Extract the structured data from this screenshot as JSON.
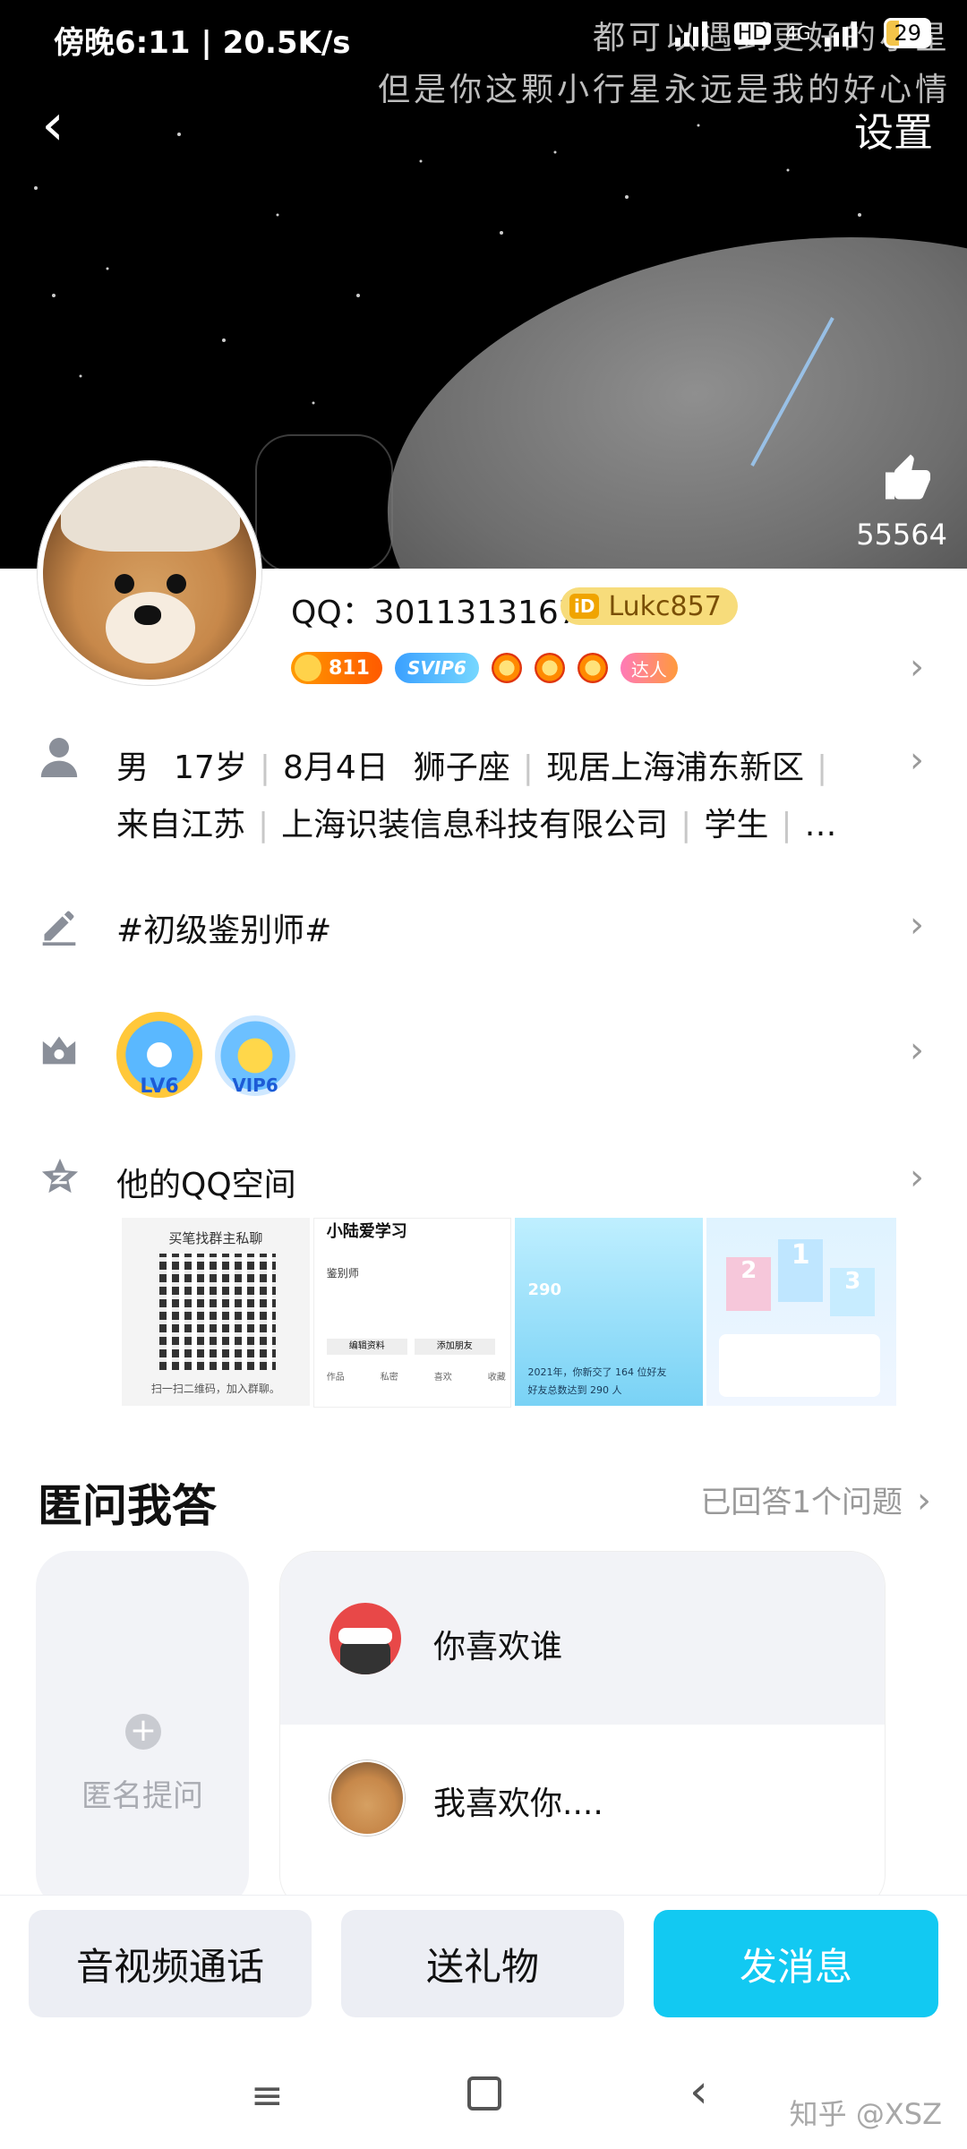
{
  "status_bar": {
    "time_speed": "傍晚6:11 | 20.5K/s",
    "hd": "HD",
    "network": "4G",
    "battery": "29"
  },
  "header": {
    "overlay_text_line1": "都可以遇到更好的小星",
    "overlay_text_line2": "但是你这颗小行星永远是我的好心情",
    "settings_label": "设置",
    "like_count": "55564",
    "back_icon": "chevron-left-icon",
    "like_icon": "thumbs-up-icon"
  },
  "profile": {
    "qq_label": "QQ：3011313167",
    "id_mark": "iD",
    "custom_id": "Lukc857",
    "level_badge": "811",
    "vip_badge": "SVIP6",
    "talent_badge": "达人"
  },
  "info_rows": {
    "basic_info_items": [
      "男",
      "17岁",
      "8月4日",
      "狮子座",
      "现居上海浦东新区"
    ],
    "basic_info_items_line2": [
      "来自江苏",
      "上海识装信息科技有限公司",
      "学生",
      "…"
    ],
    "signature": "#初级鉴别师#",
    "medals": [
      "LV6",
      "VIP6"
    ],
    "qzone_label": "他的QQ空间"
  },
  "gallery": {
    "thumb1_caption_top": "买笔找群主私聊",
    "thumb1_caption_bottom": "扫一扫二维码，加入群聊。",
    "thumb2_title": "小陆爱学习",
    "thumb2_tag": "鉴别师",
    "thumb2_tabs": [
      "作品",
      "私密",
      "喜欢",
      "收藏"
    ],
    "thumb2_buttons": [
      "编辑资料",
      "添加朋友"
    ],
    "thumb3_value": "290",
    "thumb3_line1": "2021年，你新交了 164 位好友",
    "thumb3_line2": "好友总数达到 290 人",
    "thumb4_ranks": [
      "1",
      "2",
      "3"
    ]
  },
  "qa_section": {
    "title": "匿问我答",
    "answered": "已回答1个问题",
    "ask_label": "匿名提问",
    "question": "你喜欢谁",
    "answer": "我喜欢你...."
  },
  "actions": {
    "call": "音视频通话",
    "gift": "送礼物",
    "message": "发消息"
  },
  "nav": {
    "watermark": "知乎 @XSZ"
  },
  "colors": {
    "primary": "#12c9f2",
    "header_bg": "#000000",
    "secondary_button": "#eceef4"
  }
}
